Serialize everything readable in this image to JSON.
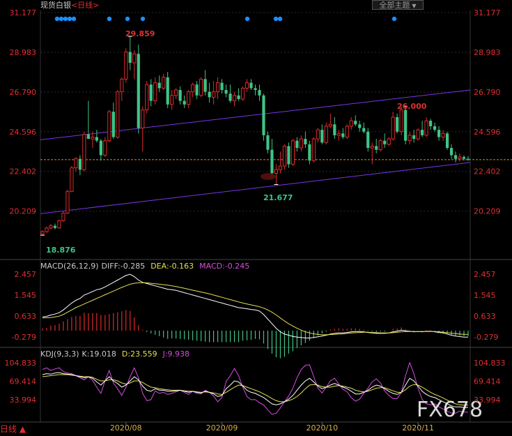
{
  "header": {
    "title": "现货白银",
    "period": "<日线>",
    "theme_button": "全部主题",
    "dots_left": 5,
    "dots_mid": 4,
    "dots_right": 1
  },
  "colors": {
    "up": "#e02b2b",
    "down": "#3fc487",
    "grid": "#2a2a2a",
    "channel": "#7a35e6",
    "price_line": "#d98f1a",
    "diff": "#ffffff",
    "dea": "#e5e054",
    "k_line": "#ffffff",
    "d_line": "#e5e054",
    "j_line": "#d64de0",
    "axis_text": "#e03030",
    "dot": "#1a8fff"
  },
  "price_panel": {
    "y_ticks": [
      "31.177",
      "28.983",
      "26.790",
      "24.596",
      "22.402",
      "20.209"
    ],
    "ylim": [
      18.0,
      31.177
    ],
    "current_price": "23.05",
    "annotations": {
      "high": "29.859",
      "low_start": "18.876",
      "low_mid": "21.677",
      "high_late": "26.000"
    }
  },
  "macd_panel": {
    "label": "MACD(26,12,9)",
    "diff": "DIFF:-0.285",
    "dea": "DEA:-0.163",
    "macd": "MACD:-0.245",
    "y_ticks": [
      "2.457",
      "1.545",
      "0.633",
      "-0.279"
    ]
  },
  "kdj_panel": {
    "label": "KDJ(9,3,3)",
    "k": "K:19.018",
    "d": "D:23.559",
    "j": "J:9.938",
    "y_ticks": [
      "104.833",
      "69.414",
      "33.994"
    ]
  },
  "x_axis": {
    "labels": [
      "2020/08",
      "2020/09",
      "2020/10",
      "2020/11"
    ]
  },
  "footer": {
    "period_label": "日线 ▲",
    "watermark": "FX678"
  },
  "chart_data": {
    "type": "candlestick",
    "title": "现货白银 <日线>",
    "x_labels": [
      "2020/08",
      "2020/09",
      "2020/10",
      "2020/11"
    ],
    "candles": [
      {
        "o": 18.95,
        "h": 19.15,
        "l": 18.88,
        "c": 19.08
      },
      {
        "o": 19.08,
        "h": 19.35,
        "l": 19.0,
        "c": 19.28
      },
      {
        "o": 19.28,
        "h": 19.5,
        "l": 19.2,
        "c": 19.4
      },
      {
        "o": 19.4,
        "h": 19.52,
        "l": 19.2,
        "c": 19.28
      },
      {
        "o": 19.28,
        "h": 19.75,
        "l": 19.25,
        "c": 19.68
      },
      {
        "o": 19.68,
        "h": 20.2,
        "l": 19.62,
        "c": 20.1
      },
      {
        "o": 20.1,
        "h": 21.4,
        "l": 20.05,
        "c": 21.3
      },
      {
        "o": 21.3,
        "h": 22.7,
        "l": 21.25,
        "c": 22.6
      },
      {
        "o": 22.6,
        "h": 23.2,
        "l": 22.4,
        "c": 23.1
      },
      {
        "o": 23.1,
        "h": 23.3,
        "l": 22.2,
        "c": 22.5
      },
      {
        "o": 22.5,
        "h": 24.6,
        "l": 22.4,
        "c": 24.45
      },
      {
        "o": 24.45,
        "h": 26.3,
        "l": 24.3,
        "c": 24.2
      },
      {
        "o": 24.2,
        "h": 24.6,
        "l": 23.7,
        "c": 24.3
      },
      {
        "o": 24.3,
        "h": 24.7,
        "l": 24.0,
        "c": 24.1
      },
      {
        "o": 24.1,
        "h": 24.2,
        "l": 23.0,
        "c": 23.3
      },
      {
        "o": 23.3,
        "h": 24.3,
        "l": 23.2,
        "c": 24.1
      },
      {
        "o": 24.1,
        "h": 25.8,
        "l": 24.0,
        "c": 25.7
      },
      {
        "o": 25.7,
        "h": 26.2,
        "l": 24.2,
        "c": 24.3
      },
      {
        "o": 24.3,
        "h": 26.9,
        "l": 24.2,
        "c": 26.8
      },
      {
        "o": 26.8,
        "h": 27.6,
        "l": 26.3,
        "c": 27.5
      },
      {
        "o": 27.5,
        "h": 29.2,
        "l": 27.3,
        "c": 29.0
      },
      {
        "o": 29.0,
        "h": 29.86,
        "l": 28.0,
        "c": 28.4
      },
      {
        "o": 28.4,
        "h": 29.1,
        "l": 27.5,
        "c": 28.9
      },
      {
        "o": 28.9,
        "h": 29.4,
        "l": 24.5,
        "c": 24.8
      },
      {
        "o": 24.8,
        "h": 26.0,
        "l": 23.5,
        "c": 25.8
      },
      {
        "o": 25.8,
        "h": 27.4,
        "l": 25.6,
        "c": 27.2
      },
      {
        "o": 27.2,
        "h": 27.5,
        "l": 26.0,
        "c": 26.3
      },
      {
        "o": 26.3,
        "h": 27.6,
        "l": 26.1,
        "c": 27.3
      },
      {
        "o": 27.3,
        "h": 27.7,
        "l": 26.8,
        "c": 27.0
      },
      {
        "o": 27.0,
        "h": 27.8,
        "l": 26.9,
        "c": 27.6
      },
      {
        "o": 27.6,
        "h": 27.9,
        "l": 25.9,
        "c": 26.1
      },
      {
        "o": 26.1,
        "h": 26.9,
        "l": 25.8,
        "c": 26.6
      },
      {
        "o": 26.6,
        "h": 27.0,
        "l": 26.4,
        "c": 26.9
      },
      {
        "o": 26.9,
        "h": 27.1,
        "l": 26.1,
        "c": 26.3
      },
      {
        "o": 26.3,
        "h": 26.6,
        "l": 25.9,
        "c": 26.1
      },
      {
        "o": 26.1,
        "h": 26.9,
        "l": 25.9,
        "c": 26.8
      },
      {
        "o": 26.8,
        "h": 27.3,
        "l": 26.5,
        "c": 27.2
      },
      {
        "o": 27.2,
        "h": 27.4,
        "l": 26.4,
        "c": 26.6
      },
      {
        "o": 26.6,
        "h": 27.6,
        "l": 26.5,
        "c": 27.5
      },
      {
        "o": 27.5,
        "h": 28.0,
        "l": 26.6,
        "c": 26.8
      },
      {
        "o": 26.8,
        "h": 27.3,
        "l": 26.2,
        "c": 26.5
      },
      {
        "o": 26.5,
        "h": 27.4,
        "l": 26.1,
        "c": 26.8
      },
      {
        "o": 26.8,
        "h": 27.6,
        "l": 26.4,
        "c": 27.3
      },
      {
        "o": 27.3,
        "h": 27.5,
        "l": 26.7,
        "c": 26.9
      },
      {
        "o": 26.9,
        "h": 27.2,
        "l": 26.5,
        "c": 26.7
      },
      {
        "o": 26.7,
        "h": 27.2,
        "l": 26.2,
        "c": 26.3
      },
      {
        "o": 26.3,
        "h": 26.8,
        "l": 26.0,
        "c": 26.6
      },
      {
        "o": 26.6,
        "h": 27.0,
        "l": 26.3,
        "c": 26.4
      },
      {
        "o": 26.4,
        "h": 27.1,
        "l": 26.3,
        "c": 27.0
      },
      {
        "o": 27.0,
        "h": 27.5,
        "l": 26.8,
        "c": 27.3
      },
      {
        "o": 27.3,
        "h": 27.5,
        "l": 26.9,
        "c": 27.0
      },
      {
        "o": 27.0,
        "h": 27.2,
        "l": 26.6,
        "c": 26.9
      },
      {
        "o": 26.9,
        "h": 27.2,
        "l": 26.3,
        "c": 26.6
      },
      {
        "o": 26.6,
        "h": 26.7,
        "l": 24.1,
        "c": 24.4
      },
      {
        "o": 24.4,
        "h": 24.6,
        "l": 23.4,
        "c": 23.6
      },
      {
        "o": 23.6,
        "h": 24.2,
        "l": 22.0,
        "c": 22.3
      },
      {
        "o": 22.3,
        "h": 22.8,
        "l": 21.68,
        "c": 22.5
      },
      {
        "o": 22.5,
        "h": 23.5,
        "l": 22.3,
        "c": 22.7
      },
      {
        "o": 22.7,
        "h": 23.9,
        "l": 22.5,
        "c": 23.8
      },
      {
        "o": 23.8,
        "h": 24.0,
        "l": 22.6,
        "c": 22.8
      },
      {
        "o": 22.8,
        "h": 24.2,
        "l": 22.7,
        "c": 24.1
      },
      {
        "o": 24.1,
        "h": 24.3,
        "l": 23.5,
        "c": 23.7
      },
      {
        "o": 23.7,
        "h": 24.4,
        "l": 23.5,
        "c": 24.2
      },
      {
        "o": 24.2,
        "h": 24.6,
        "l": 23.7,
        "c": 23.9
      },
      {
        "o": 23.9,
        "h": 24.1,
        "l": 22.8,
        "c": 23.0
      },
      {
        "o": 23.0,
        "h": 24.3,
        "l": 22.9,
        "c": 24.2
      },
      {
        "o": 24.2,
        "h": 24.8,
        "l": 24.0,
        "c": 24.7
      },
      {
        "o": 24.7,
        "h": 25.0,
        "l": 23.9,
        "c": 24.0
      },
      {
        "o": 24.0,
        "h": 25.1,
        "l": 23.9,
        "c": 24.9
      },
      {
        "o": 24.9,
        "h": 25.6,
        "l": 24.8,
        "c": 25.0
      },
      {
        "o": 25.0,
        "h": 25.4,
        "l": 24.2,
        "c": 24.4
      },
      {
        "o": 24.4,
        "h": 24.7,
        "l": 24.1,
        "c": 24.5
      },
      {
        "o": 24.5,
        "h": 24.8,
        "l": 24.2,
        "c": 24.3
      },
      {
        "o": 24.3,
        "h": 25.0,
        "l": 24.2,
        "c": 24.9
      },
      {
        "o": 24.9,
        "h": 25.4,
        "l": 24.7,
        "c": 25.2
      },
      {
        "o": 25.2,
        "h": 25.5,
        "l": 24.9,
        "c": 25.0
      },
      {
        "o": 25.0,
        "h": 25.2,
        "l": 24.6,
        "c": 24.8
      },
      {
        "o": 24.8,
        "h": 25.1,
        "l": 24.5,
        "c": 24.6
      },
      {
        "o": 24.6,
        "h": 24.8,
        "l": 23.5,
        "c": 23.7
      },
      {
        "o": 23.7,
        "h": 24.0,
        "l": 22.8,
        "c": 23.8
      },
      {
        "o": 23.8,
        "h": 24.2,
        "l": 23.4,
        "c": 23.6
      },
      {
        "o": 23.6,
        "h": 24.2,
        "l": 23.5,
        "c": 24.1
      },
      {
        "o": 24.1,
        "h": 24.5,
        "l": 23.7,
        "c": 23.9
      },
      {
        "o": 23.9,
        "h": 24.3,
        "l": 23.8,
        "c": 24.2
      },
      {
        "o": 24.2,
        "h": 25.7,
        "l": 24.1,
        "c": 25.4
      },
      {
        "o": 25.4,
        "h": 25.6,
        "l": 24.5,
        "c": 24.6
      },
      {
        "o": 24.6,
        "h": 26.0,
        "l": 24.4,
        "c": 25.8
      },
      {
        "o": 25.8,
        "h": 26.0,
        "l": 23.9,
        "c": 24.1
      },
      {
        "o": 24.1,
        "h": 24.6,
        "l": 23.9,
        "c": 24.4
      },
      {
        "o": 24.4,
        "h": 24.7,
        "l": 24.0,
        "c": 24.2
      },
      {
        "o": 24.2,
        "h": 24.8,
        "l": 24.1,
        "c": 24.7
      },
      {
        "o": 24.7,
        "h": 25.2,
        "l": 24.3,
        "c": 24.4
      },
      {
        "o": 24.4,
        "h": 25.4,
        "l": 24.3,
        "c": 25.2
      },
      {
        "o": 25.2,
        "h": 25.3,
        "l": 24.7,
        "c": 24.9
      },
      {
        "o": 24.9,
        "h": 25.1,
        "l": 24.6,
        "c": 24.7
      },
      {
        "o": 24.7,
        "h": 24.9,
        "l": 24.1,
        "c": 24.3
      },
      {
        "o": 24.3,
        "h": 24.7,
        "l": 24.1,
        "c": 24.5
      },
      {
        "o": 24.5,
        "h": 24.6,
        "l": 23.6,
        "c": 23.7
      },
      {
        "o": 23.7,
        "h": 23.9,
        "l": 23.1,
        "c": 23.3
      },
      {
        "o": 23.3,
        "h": 23.5,
        "l": 22.9,
        "c": 23.1
      },
      {
        "o": 23.1,
        "h": 23.4,
        "l": 22.95,
        "c": 23.2
      },
      {
        "o": 23.2,
        "h": 23.3,
        "l": 23.0,
        "c": 23.1
      },
      {
        "o": 23.1,
        "h": 23.25,
        "l": 22.98,
        "c": 23.05
      }
    ],
    "channel": {
      "upper": [
        {
          "x": 0,
          "y": 24.15
        },
        {
          "x": 102,
          "y": 26.9
        }
      ],
      "lower": [
        {
          "x": 0,
          "y": 20.07
        },
        {
          "x": 102,
          "y": 22.9
        }
      ]
    },
    "macd": {
      "diff": [
        0.6,
        0.62,
        0.68,
        0.72,
        0.78,
        0.9,
        1.05,
        1.2,
        1.32,
        1.4,
        1.55,
        1.62,
        1.7,
        1.78,
        1.82,
        1.9,
        2.0,
        2.1,
        2.2,
        2.3,
        2.4,
        2.45,
        2.35,
        2.2,
        2.1,
        2.05,
        2.0,
        1.95,
        1.9,
        1.85,
        1.8,
        1.78,
        1.75,
        1.7,
        1.65,
        1.6,
        1.55,
        1.5,
        1.45,
        1.4,
        1.35,
        1.3,
        1.25,
        1.2,
        1.15,
        1.1,
        1.05,
        1.0,
        0.98,
        0.95,
        0.92,
        0.9,
        0.85,
        0.7,
        0.5,
        0.3,
        0.1,
        -0.05,
        -0.15,
        -0.2,
        -0.25,
        -0.28,
        -0.3,
        -0.32,
        -0.32,
        -0.3,
        -0.27,
        -0.24,
        -0.2,
        -0.15,
        -0.12,
        -0.1,
        -0.1,
        -0.08,
        -0.05,
        -0.04,
        -0.04,
        -0.05,
        -0.08,
        -0.1,
        -0.12,
        -0.12,
        -0.12,
        -0.1,
        -0.05,
        -0.02,
        0.02,
        -0.01,
        -0.03,
        -0.05,
        -0.04,
        -0.05,
        -0.03,
        -0.03,
        -0.05,
        -0.08,
        -0.1,
        -0.15,
        -0.2,
        -0.24,
        -0.26,
        -0.28,
        -0.285
      ],
      "dea": [
        0.55,
        0.56,
        0.57,
        0.6,
        0.63,
        0.7,
        0.8,
        0.9,
        1.0,
        1.08,
        1.16,
        1.24,
        1.32,
        1.4,
        1.48,
        1.56,
        1.64,
        1.72,
        1.8,
        1.88,
        1.95,
        2.02,
        2.06,
        2.08,
        2.08,
        2.08,
        2.06,
        2.04,
        2.02,
        2.0,
        1.98,
        1.95,
        1.92,
        1.88,
        1.84,
        1.8,
        1.76,
        1.72,
        1.68,
        1.64,
        1.6,
        1.55,
        1.5,
        1.45,
        1.4,
        1.35,
        1.3,
        1.25,
        1.2,
        1.16,
        1.12,
        1.08,
        1.04,
        0.98,
        0.9,
        0.8,
        0.68,
        0.55,
        0.42,
        0.3,
        0.2,
        0.1,
        0.02,
        -0.05,
        -0.1,
        -0.14,
        -0.16,
        -0.18,
        -0.18,
        -0.17,
        -0.16,
        -0.15,
        -0.14,
        -0.12,
        -0.1,
        -0.09,
        -0.08,
        -0.07,
        -0.07,
        -0.08,
        -0.09,
        -0.1,
        -0.1,
        -0.1,
        -0.09,
        -0.07,
        -0.05,
        -0.04,
        -0.04,
        -0.04,
        -0.04,
        -0.04,
        -0.04,
        -0.04,
        -0.04,
        -0.05,
        -0.07,
        -0.09,
        -0.11,
        -0.13,
        -0.15,
        -0.16,
        -0.163
      ]
    },
    "kdj": {
      "k": [
        82,
        84,
        83,
        85,
        86,
        84,
        83,
        82,
        80,
        78,
        76,
        78,
        75,
        68,
        62,
        70,
        78,
        70,
        65,
        58,
        62,
        70,
        78,
        72,
        60,
        52,
        50,
        55,
        52,
        52,
        50,
        50,
        51,
        52,
        50,
        48,
        50,
        48,
        47,
        50,
        48,
        45,
        40,
        42,
        55,
        62,
        70,
        68,
        60,
        52,
        48,
        46,
        42,
        38,
        32,
        26,
        24,
        26,
        30,
        35,
        42,
        52,
        62,
        70,
        75,
        68,
        60,
        55,
        58,
        62,
        65,
        62,
        58,
        55,
        50,
        45,
        45,
        48,
        52,
        58,
        62,
        60,
        55,
        50,
        46,
        44,
        48,
        62,
        75,
        70,
        60,
        50,
        44,
        40,
        38,
        34,
        30,
        26,
        22,
        20,
        20,
        19,
        19.018
      ],
      "d": [
        78,
        79,
        80,
        81,
        82,
        82,
        82,
        81,
        80,
        79,
        78,
        78,
        77,
        73,
        70,
        70,
        72,
        72,
        70,
        66,
        64,
        66,
        70,
        70,
        67,
        62,
        58,
        57,
        55,
        54,
        53,
        52,
        52,
        52,
        51,
        50,
        50,
        49,
        48,
        49,
        48,
        47,
        45,
        44,
        48,
        53,
        58,
        62,
        61,
        58,
        55,
        52,
        49,
        45,
        41,
        36,
        32,
        30,
        30,
        32,
        35,
        40,
        47,
        55,
        62,
        63,
        62,
        59,
        58,
        58,
        60,
        61,
        60,
        58,
        56,
        52,
        50,
        49,
        50,
        53,
        56,
        57,
        57,
        54,
        51,
        48,
        48,
        53,
        60,
        63,
        62,
        58,
        53,
        48,
        44,
        41,
        37,
        33,
        29,
        26,
        24,
        23.7,
        23.559
      ],
      "j": [
        92,
        95,
        90,
        93,
        95,
        88,
        85,
        84,
        80,
        76,
        72,
        78,
        71,
        58,
        46,
        70,
        90,
        66,
        55,
        42,
        58,
        78,
        95,
        76,
        46,
        32,
        34,
        51,
        46,
        48,
        44,
        46,
        49,
        52,
        48,
        44,
        50,
        46,
        45,
        52,
        48,
        41,
        30,
        38,
        69,
        80,
        94,
        80,
        58,
        40,
        34,
        34,
        28,
        24,
        14,
        6,
        8,
        18,
        30,
        41,
        56,
        76,
        92,
        100,
        101,
        78,
        56,
        47,
        58,
        70,
        75,
        64,
        54,
        49,
        38,
        31,
        35,
        46,
        56,
        68,
        74,
        66,
        51,
        42,
        36,
        36,
        48,
        80,
        105,
        84,
        56,
        34,
        26,
        24,
        26,
        20,
        16,
        12,
        8,
        8,
        12,
        10,
        9.938
      ]
    },
    "ylim": [
      18.0,
      31.177
    ]
  }
}
